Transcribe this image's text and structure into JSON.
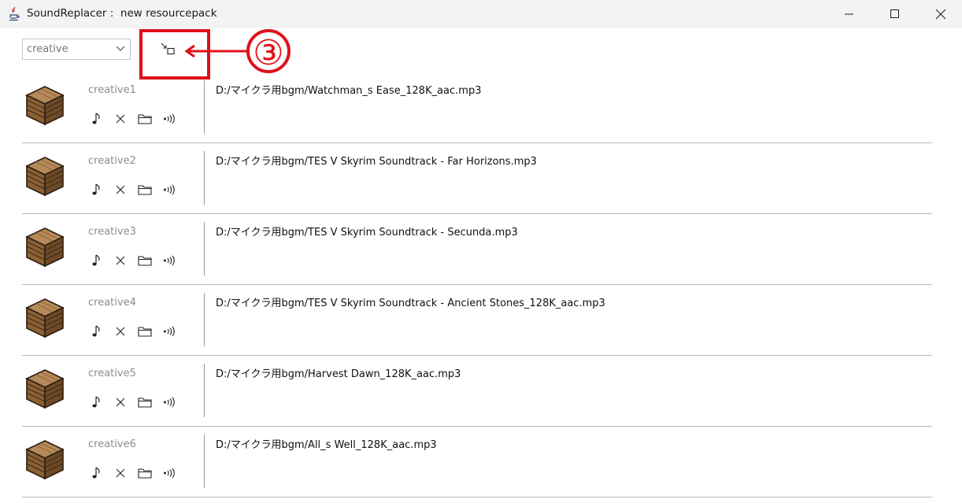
{
  "window": {
    "title": "SoundReplacer :  new resourcepack",
    "controls": [
      "minimize-icon",
      "maximize-icon",
      "close-icon"
    ]
  },
  "toolbar": {
    "category_select": {
      "value": "creative"
    },
    "tool_button_icon": "collapse-arrow-icon"
  },
  "annotation": {
    "step_label": "③",
    "color": "#e0101a"
  },
  "tracks": [
    {
      "name": "creative1",
      "path": "D:/マイクラ用bgm/Watchman_s Ease_128K_aac.mp3"
    },
    {
      "name": "creative2",
      "path": "D:/マイクラ用bgm/TES V Skyrim Soundtrack - Far Horizons.mp3"
    },
    {
      "name": "creative3",
      "path": "D:/マイクラ用bgm/TES V Skyrim Soundtrack - Secunda.mp3"
    },
    {
      "name": "creative4",
      "path": "D:/マイクラ用bgm/TES V Skyrim Soundtrack - Ancient Stones_128K_aac.mp3"
    },
    {
      "name": "creative5",
      "path": "D:/マイクラ用bgm/Harvest Dawn_128K_aac.mp3"
    },
    {
      "name": "creative6",
      "path": "D:/マイクラ用bgm/All_s Well_128K_aac.mp3"
    }
  ],
  "row_actions": [
    "music-note-icon",
    "delete-x-icon",
    "folder-icon",
    "play-sound-icon"
  ]
}
